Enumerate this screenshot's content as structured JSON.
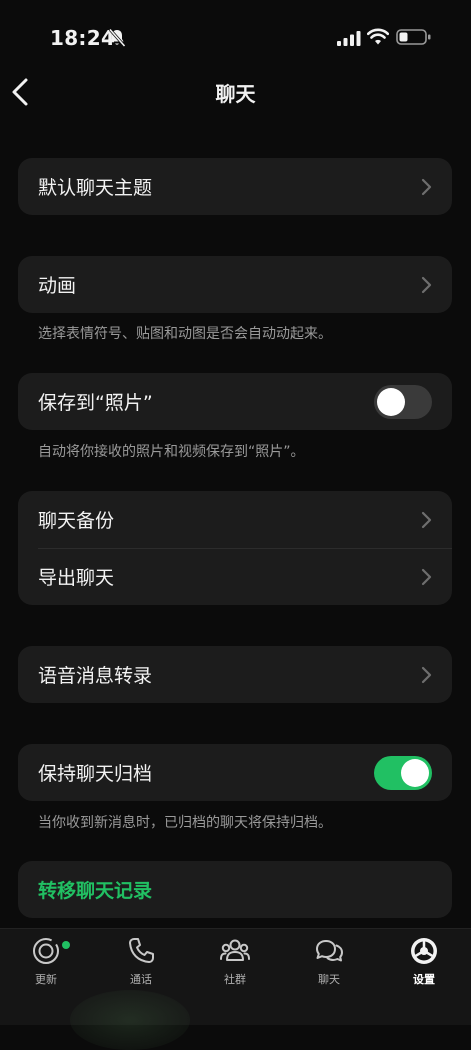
{
  "status": {
    "time": "18:24"
  },
  "nav": {
    "title": "聊天"
  },
  "sections": {
    "theme": {
      "label": "默认聊天主题"
    },
    "animation": {
      "label": "动画",
      "note": "选择表情符号、贴图和动图是否会自动动起来。"
    },
    "save_to_photos": {
      "label": "保存到“照片”",
      "note": "自动将你接收的照片和视频保存到“照片”。",
      "enabled": false
    },
    "backup": {
      "items": [
        {
          "label": "聊天备份"
        },
        {
          "label": "导出聊天"
        }
      ]
    },
    "voice_transcript": {
      "label": "语音消息转录"
    },
    "keep_archived": {
      "label": "保持聊天归档",
      "note": "当你收到新消息时，已归档的聊天将保持归档。",
      "enabled": true
    },
    "transfer": {
      "label": "转移聊天记录"
    }
  },
  "tabbar": {
    "items": [
      {
        "label": "更新",
        "icon": "updates-icon"
      },
      {
        "label": "通话",
        "icon": "phone-icon"
      },
      {
        "label": "社群",
        "icon": "communities-icon"
      },
      {
        "label": "聊天",
        "icon": "chats-icon"
      },
      {
        "label": "设置",
        "icon": "settings-icon"
      }
    ],
    "active": "设置"
  },
  "colors": {
    "accent": "#21c063",
    "background": "#0b0b0b",
    "card": "#1c1c1c"
  }
}
